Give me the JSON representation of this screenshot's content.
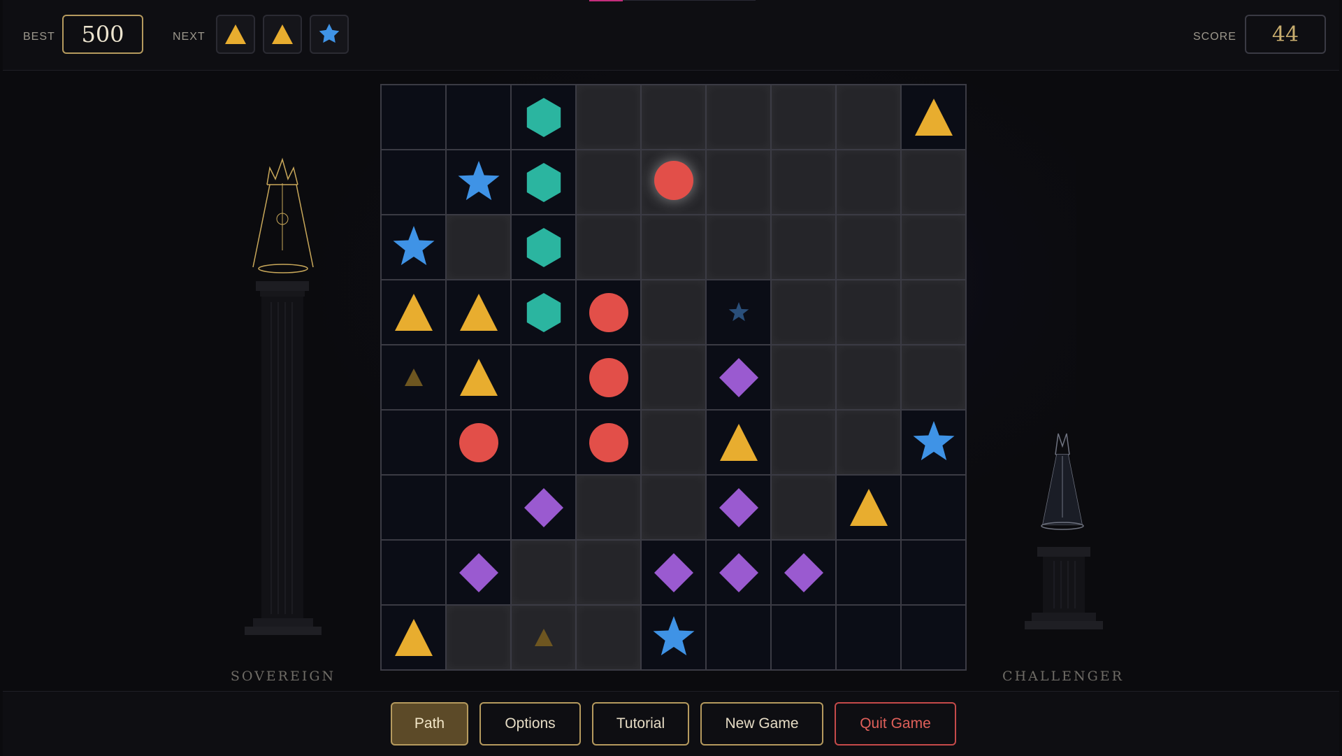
{
  "header": {
    "best_label": "BEST",
    "best_value": "500",
    "next_label": "NEXT",
    "next_pieces": [
      "triangle",
      "triangle",
      "star"
    ],
    "score_label": "SCORE",
    "score_value": "44"
  },
  "players": {
    "left_label": "SOVEREIGN",
    "right_label": "CHALLENGER"
  },
  "buttons": {
    "path": "Path",
    "options": "Options",
    "tutorial": "Tutorial",
    "new_game": "New Game",
    "quit_game": "Quit Game"
  },
  "colors": {
    "triangle": "#e8ad2f",
    "star": "#3f93e6",
    "hexagon": "#2bb5a0",
    "circle": "#e24f49",
    "diamond": "#9a5ad0",
    "accent": "#b59a5e",
    "danger": "#c54a4a"
  },
  "board": {
    "rows": 9,
    "cols": 9,
    "legend": {
      "T": "triangle",
      "S": "star",
      "H": "hexagon",
      "C": "circle",
      "D": "diamond",
      "t": "triangle-small",
      "s": "star-small",
      "c": "circle-selected"
    },
    "grid": [
      "..H.....T",
      ".SH.c....",
      "S.H......",
      "TTHC.s...",
      "tT.C.D...",
      ".C.C.T..S",
      "..D..D.T.",
      ".D..DDD..",
      "T.t.S...."
    ],
    "highlighted": [
      "...LLLLL.",
      "...LLLLLL",
      ".L.LLLLLL",
      "....L.LLL",
      "....L.LLL",
      "....L.LL.",
      "...LL.L..",
      "..LL.....",
      ".LLL....."
    ]
  }
}
